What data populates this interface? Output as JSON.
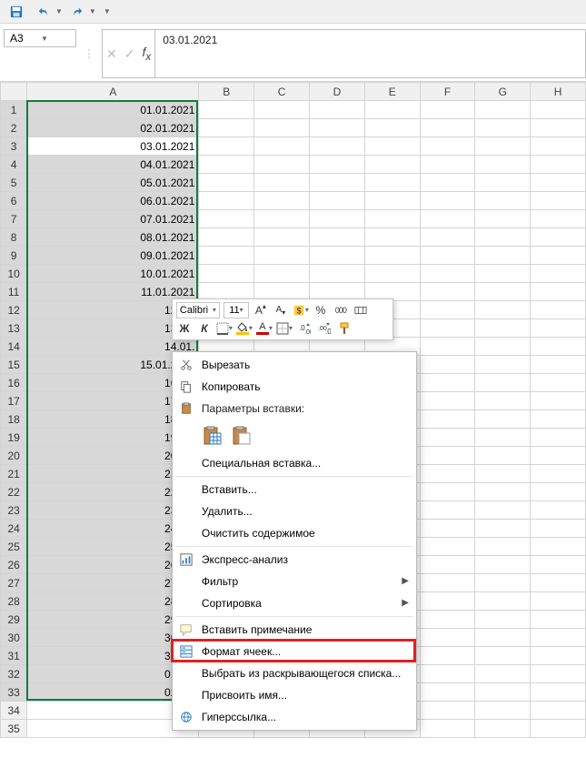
{
  "qat": {
    "save": "save",
    "undo": "undo",
    "redo": "redo"
  },
  "nameBox": "A3",
  "formulaValue": "03.01.2021",
  "columns": [
    "A",
    "B",
    "C",
    "D",
    "E",
    "F",
    "G",
    "H"
  ],
  "activeRow": 3,
  "selRows": 33,
  "cells": {
    "A": [
      "01.01.2021",
      "02.01.2021",
      "03.01.2021",
      "04.01.2021",
      "05.01.2021",
      "06.01.2021",
      "07.01.2021",
      "08.01.2021",
      "09.01.2021",
      "10.01.2021",
      "11.01.2021",
      "12.01.",
      "13.01.",
      "14.01.",
      "15.01.2021",
      "16.01.",
      "17.01.",
      "18.01.",
      "19.01.",
      "20.01.",
      "21.01.",
      "22.01.",
      "23.01.",
      "24.01.",
      "25.01.",
      "26.01.",
      "27.01.",
      "28.01.",
      "29.01.",
      "30.01.",
      "31.01.",
      "01.02.",
      "02.02."
    ]
  },
  "rowsTotal": 35,
  "miniToolbar": {
    "fontName": "Calibri",
    "fontSize": "11",
    "increaseFont": "A▲",
    "decreaseFont": "A▼",
    "percent": "%",
    "thousands": "000",
    "bold": "Ж",
    "italic": "К",
    "fill": "fill",
    "fontColor": "A",
    "border": "border",
    "decInc": "dec",
    "decDec": "dec",
    "painter": "painter"
  },
  "ctx": {
    "cut": "Вырезать",
    "copy": "Копировать",
    "pasteOptionsHeader": "Параметры вставки:",
    "pasteSpecial": "Специальная вставка...",
    "insert": "Вставить...",
    "delete": "Удалить...",
    "clear": "Очистить содержимое",
    "quickAnalysis": "Экспресс-анализ",
    "filter": "Фильтр",
    "sort": "Сортировка",
    "insertComment": "Вставить примечание",
    "formatCells": "Формат ячеек...",
    "pickFromList": "Выбрать из раскрывающегося списка...",
    "defineName": "Присвоить имя...",
    "hyperlink": "Гиперссылка..."
  }
}
